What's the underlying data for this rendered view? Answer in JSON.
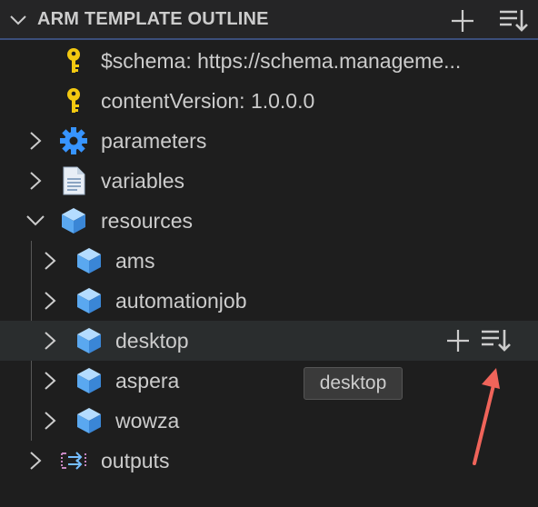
{
  "panel": {
    "title": "ARM TEMPLATE OUTLINE",
    "expanded": true,
    "actions": [
      "add-icon",
      "sort-icon"
    ]
  },
  "tree": {
    "items": [
      {
        "label": "$schema: https://schema.manageme...",
        "icon": "key-icon",
        "level": 1,
        "expandable": false
      },
      {
        "label": "contentVersion: 1.0.0.0",
        "icon": "key-icon",
        "level": 1,
        "expandable": false
      },
      {
        "label": "parameters",
        "icon": "gear-icon",
        "level": 1,
        "expandable": true,
        "expanded": false
      },
      {
        "label": "variables",
        "icon": "file-icon",
        "level": 1,
        "expandable": true,
        "expanded": false
      },
      {
        "label": "resources",
        "icon": "cube-icon",
        "level": 1,
        "expandable": true,
        "expanded": true
      },
      {
        "label": "ams",
        "icon": "cube-icon",
        "level": 2,
        "expandable": true,
        "expanded": false
      },
      {
        "label": "automationjob",
        "icon": "cube-icon",
        "level": 2,
        "expandable": true,
        "expanded": false
      },
      {
        "label": "desktop",
        "icon": "cube-icon",
        "level": 2,
        "expandable": true,
        "expanded": false,
        "hovered": true
      },
      {
        "label": "aspera",
        "icon": "cube-icon",
        "level": 2,
        "expandable": true,
        "expanded": false
      },
      {
        "label": "wowza",
        "icon": "cube-icon",
        "level": 2,
        "expandable": true,
        "expanded": false
      },
      {
        "label": "outputs",
        "icon": "outputs-icon",
        "level": 1,
        "expandable": true,
        "expanded": false
      }
    ]
  },
  "tooltip": {
    "text": "desktop"
  },
  "colors": {
    "background": "#1e1e1e",
    "header_background": "#252526",
    "hover_row": "#2a2d2e",
    "text": "#cccccc",
    "key": "#f2c811",
    "gear": "#3794ff",
    "cube": "#75beff",
    "annotation_arrow": "#f0645a"
  }
}
